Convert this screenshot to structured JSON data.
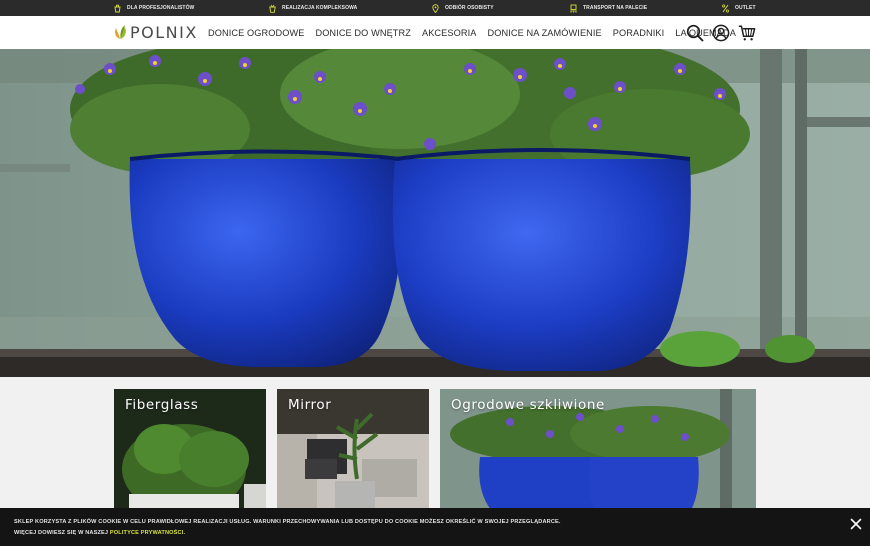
{
  "topbar": {
    "items": [
      {
        "label": "DLA PROFESJONALISTÓW",
        "icon": "hand-pot-icon"
      },
      {
        "label": "REALIZACJA KOMPLEKSOWA",
        "icon": "pot-icon"
      },
      {
        "label": "ODBIÓR OSOBISTY",
        "icon": "location-pin-icon"
      },
      {
        "label": "TRANSPORT NA PALECIE",
        "icon": "pallet-icon"
      },
      {
        "label": "OUTLET",
        "icon": "percent-icon"
      }
    ]
  },
  "header": {
    "logo_text": "POLNIX",
    "nav": [
      "DONICE OGRODOWE",
      "DONICE DO WNĘTRZ",
      "AKCESORIA",
      "DONICE NA ZAMÓWIENIE",
      "PORADNIKI",
      "LA QUEMADA"
    ],
    "icons": [
      "search-icon",
      "account-icon",
      "cart-icon"
    ]
  },
  "hero": {
    "slides_count": 5,
    "active_slide": 2
  },
  "categories": [
    {
      "title": "Fiberglass"
    },
    {
      "title": "Mirror"
    },
    {
      "title": "Ogrodowe szkliwione"
    }
  ],
  "cookie": {
    "line1": "SKLEP KORZYSTA Z PLIKÓW COOKIE W CELU PRAWIDŁOWEJ REALIZACJI USŁUG. WARUNKI PRZECHOWYWANIA LUB DOSTĘPU DO COOKIE MOŻESZ OKREŚLIĆ W SWOJEJ PRZEGLĄDARCE.",
    "line2_prefix": "WIĘCEJ DOWIESZ SIĘ W NASZEJ ",
    "line2_link": "POLITYCE PRYWATNOŚCI",
    "line2_suffix": "."
  },
  "colors": {
    "topbar_bg": "#2b2b2b",
    "accent_yellow": "#d8e03a",
    "pot_blue": "#1f3fc4",
    "cookie_bg": "#141414"
  }
}
